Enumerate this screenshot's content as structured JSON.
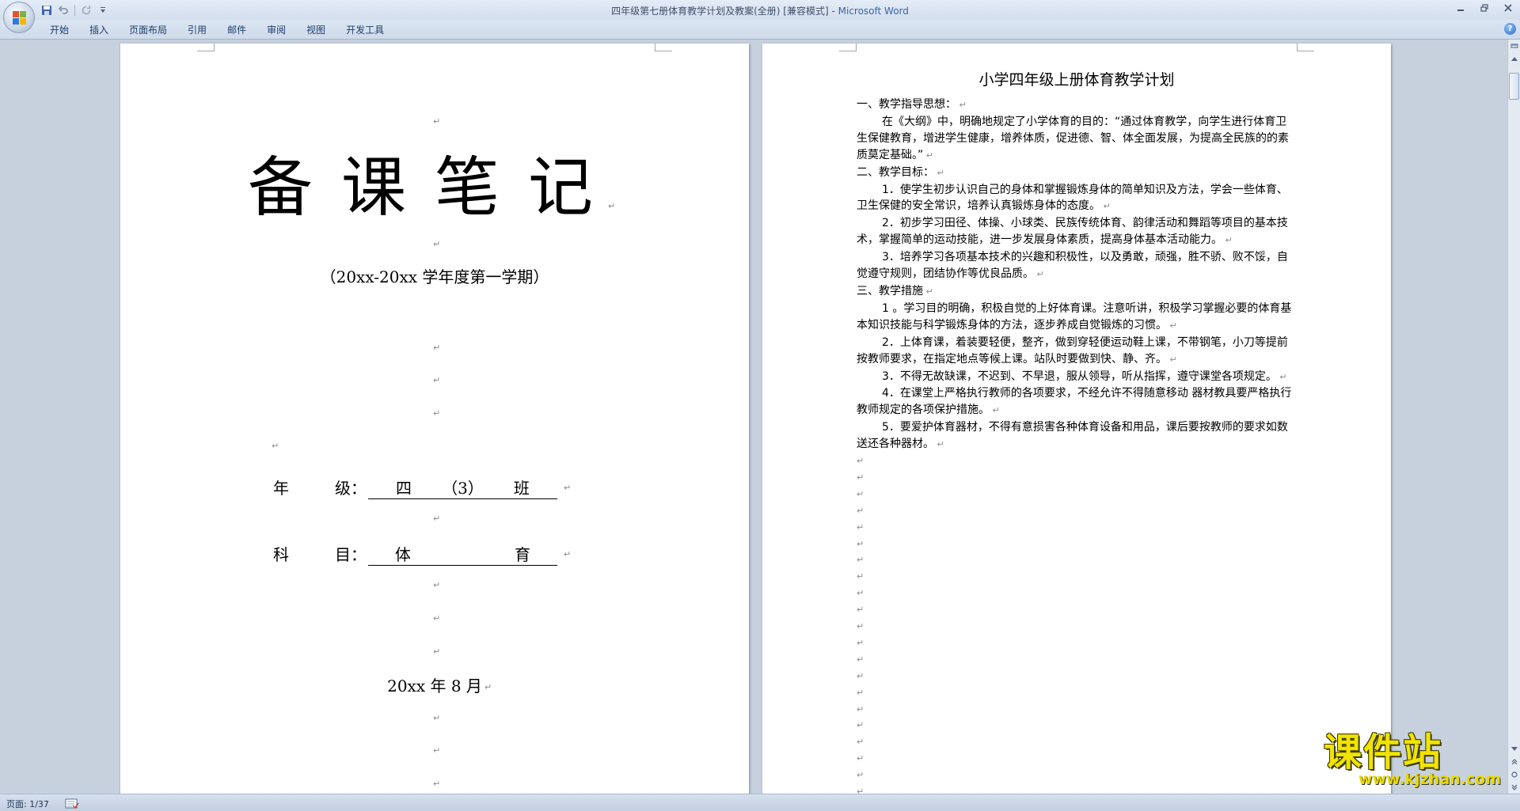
{
  "window": {
    "title": "四年级第七册体育教学计划及教案(全册) [兼容模式]",
    "title_sep": " - ",
    "app_name": "Microsoft Word"
  },
  "ribbon": {
    "tabs": [
      "开始",
      "插入",
      "页面布局",
      "引用",
      "邮件",
      "审阅",
      "视图",
      "开发工具"
    ],
    "help": "?"
  },
  "cover_page": {
    "title": "备课笔记",
    "subtitle": "（20xx-20xx 学年度第一学期）",
    "grade_label": [
      "年",
      "级："
    ],
    "grade_value": [
      "四",
      "（3）",
      "班"
    ],
    "subject_label": [
      "科",
      "目："
    ],
    "subject_value": [
      "体",
      "育"
    ],
    "date": "20xx 年 8 月"
  },
  "plan_page": {
    "title": "小学四年级上册体育教学计划",
    "paragraphs": [
      {
        "text": "一、教学指导思想：",
        "indent": false
      },
      {
        "text": "在《大纲》中，明确地规定了小学体育的目的：“通过体育教学，向学生进行体育卫生保健教育，增进学生健康，增养体质，促进德、智、体全面发展，为提高全民族的的素质莫定基础。”",
        "indent": true
      },
      {
        "text": "二、教学目标：",
        "indent": false
      },
      {
        "text": "1．使学生初步认识自己的身体和掌握锻炼身体的简单知识及方法，学会一些体育、卫生保健的安全常识，培养认真锻炼身体的态度。",
        "indent": true
      },
      {
        "text": "2．初步学习田径、体操、小球类、民族传统体育、韵律活动和舞蹈等项目的基本技术，掌握简单的运动技能，进一步发展身体素质，提高身体基本活动能力。",
        "indent": true
      },
      {
        "text": "3．培养学习各项基本技术的兴趣和积极性，以及勇敢，顽强，胜不骄、败不馁，自觉遵守规则，团结协作等优良品质。",
        "indent": true
      },
      {
        "text": "三、教学措施",
        "indent": false
      },
      {
        "text": "1 。学习目的明确，积极自觉的上好体育课。注意听讲，积极学习掌握必要的体育基本知识技能与科学锻炼身体的方法，逐步养成自觉锻炼的习惯。",
        "indent": true
      },
      {
        "text": "2．上体育课，着装要轻便，整齐，做到穿轻便运动鞋上课，不带钢笔，小刀等提前按教师要求，在指定地点等候上课。站队时要做到快、静、齐。",
        "indent": true
      },
      {
        "text": "3．不得无故缺课，不迟到、不早退，服从领导，听从指挥，遵守课堂各项规定。",
        "indent": true
      },
      {
        "text": "4．在课堂上严格执行教师的各项要求，不经允许不得随意移动 器材教具要严格执行教师规定的各项保护措施。",
        "indent": true
      },
      {
        "text": "5．要爱护体育器材，不得有意损害各种体育设备和用品，课后要按教师的要求如数送还各种器材。",
        "indent": true
      }
    ]
  },
  "status": {
    "page": "页面: 1/37"
  },
  "watermark": {
    "title": "课件站",
    "url": "www.kjzhan.com"
  },
  "colors": {
    "app_name": "#3a66a8",
    "workspace": "#c7d1de",
    "watermark": "#f2e300"
  }
}
